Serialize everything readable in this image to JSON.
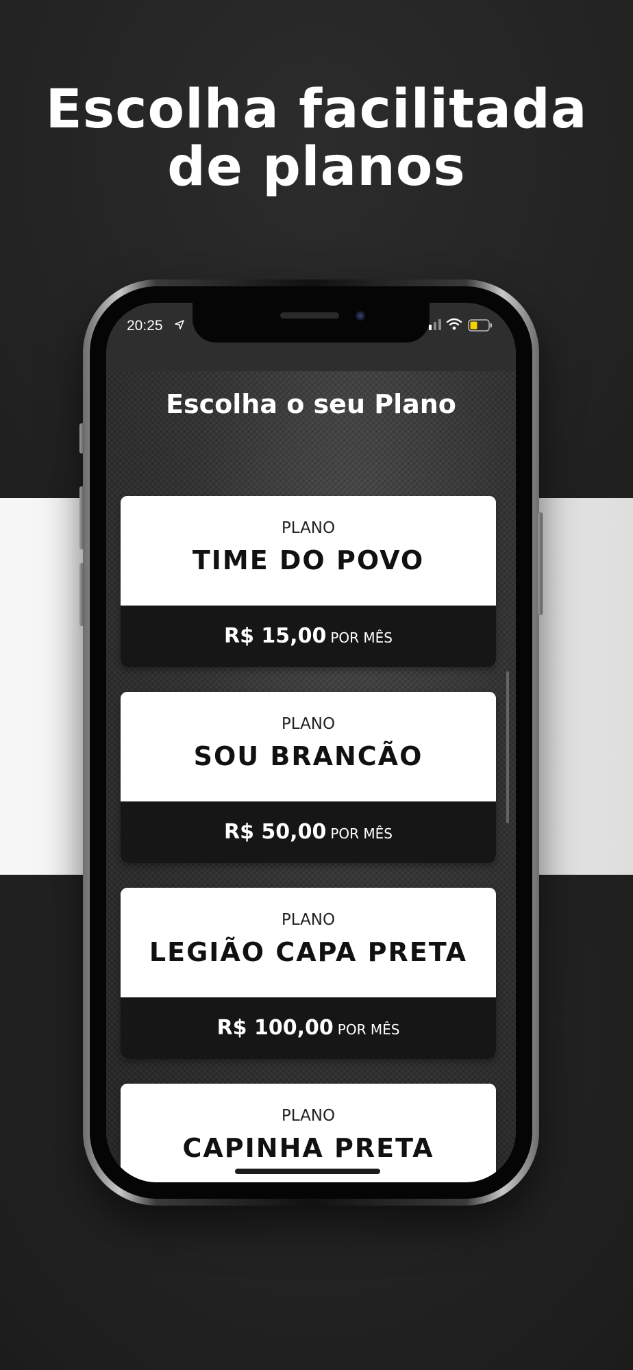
{
  "headline": {
    "line1": "Escolha facilitada",
    "line2": "de planos"
  },
  "status_bar": {
    "time": "20:25",
    "icons": [
      "location-arrow-icon",
      "signal-icon",
      "wifi-icon",
      "battery-icon"
    ],
    "battery_color": "#f5d000"
  },
  "screen": {
    "title": "Escolha o seu Plano"
  },
  "plans": [
    {
      "label": "PLANO",
      "name": "TIME DO POVO",
      "price": "R$ 15,00",
      "period": "POR MÊS"
    },
    {
      "label": "PLANO",
      "name": "SOU BRANCÃO",
      "price": "R$ 50,00",
      "period": "POR MÊS"
    },
    {
      "label": "PLANO",
      "name": "LEGIÃO CAPA PRETA",
      "price": "R$ 100,00",
      "period": "POR MÊS"
    },
    {
      "label": "PLANO",
      "name": "CAPINHA PRETA"
    }
  ],
  "colors": {
    "background_dark": "#242424",
    "stripe_light": "#efefef",
    "card_white": "#ffffff",
    "price_bar": "#161616",
    "text_white": "#ffffff"
  }
}
